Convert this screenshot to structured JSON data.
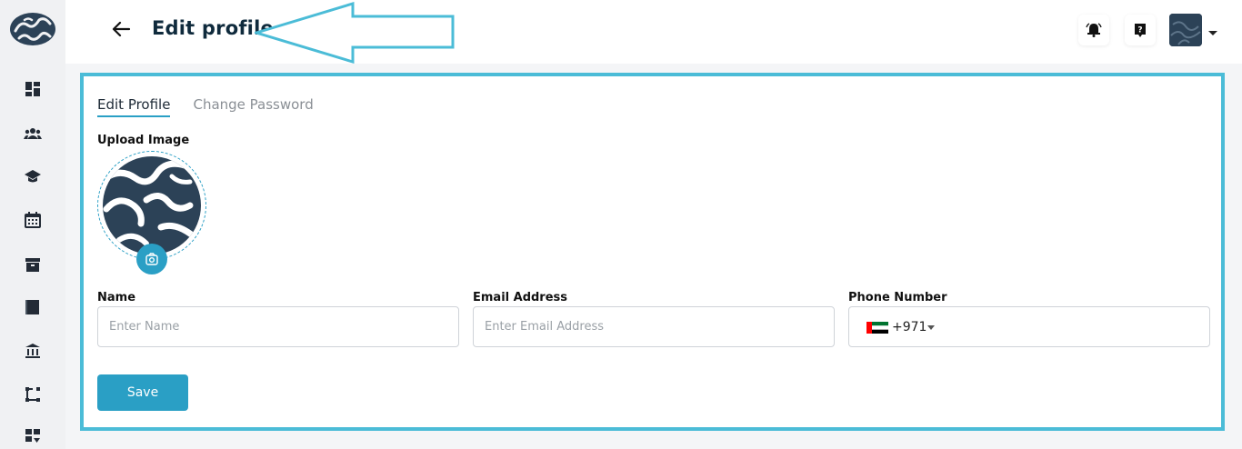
{
  "header": {
    "title": "Edit profile",
    "back_icon": "arrow-left-icon",
    "notification_icon": "alarm-bell-icon",
    "help_icon": "question-icon"
  },
  "sidebar": {
    "items": [
      {
        "icon": "dashboard-icon"
      },
      {
        "icon": "users-icon"
      },
      {
        "icon": "graduation-cap-icon"
      },
      {
        "icon": "calendar-icon"
      },
      {
        "icon": "archive-box-icon"
      },
      {
        "icon": "book-icon"
      },
      {
        "icon": "bank-icon"
      },
      {
        "icon": "workflow-icon"
      },
      {
        "icon": "grid-arrow-icon"
      }
    ]
  },
  "tabs": [
    {
      "label": "Edit Profile",
      "active": true
    },
    {
      "label": "Change Password",
      "active": false
    }
  ],
  "form": {
    "upload_label": "Upload Image",
    "name_label": "Name",
    "name_placeholder": "Enter Name",
    "email_label": "Email Address",
    "email_placeholder": "Enter Email Address",
    "phone_label": "Phone Number",
    "dial_code": "+971",
    "save_label": "Save"
  },
  "colors": {
    "accent": "#2a9fc5",
    "annotation": "#4bbcd7",
    "dark": "#2c4257"
  }
}
